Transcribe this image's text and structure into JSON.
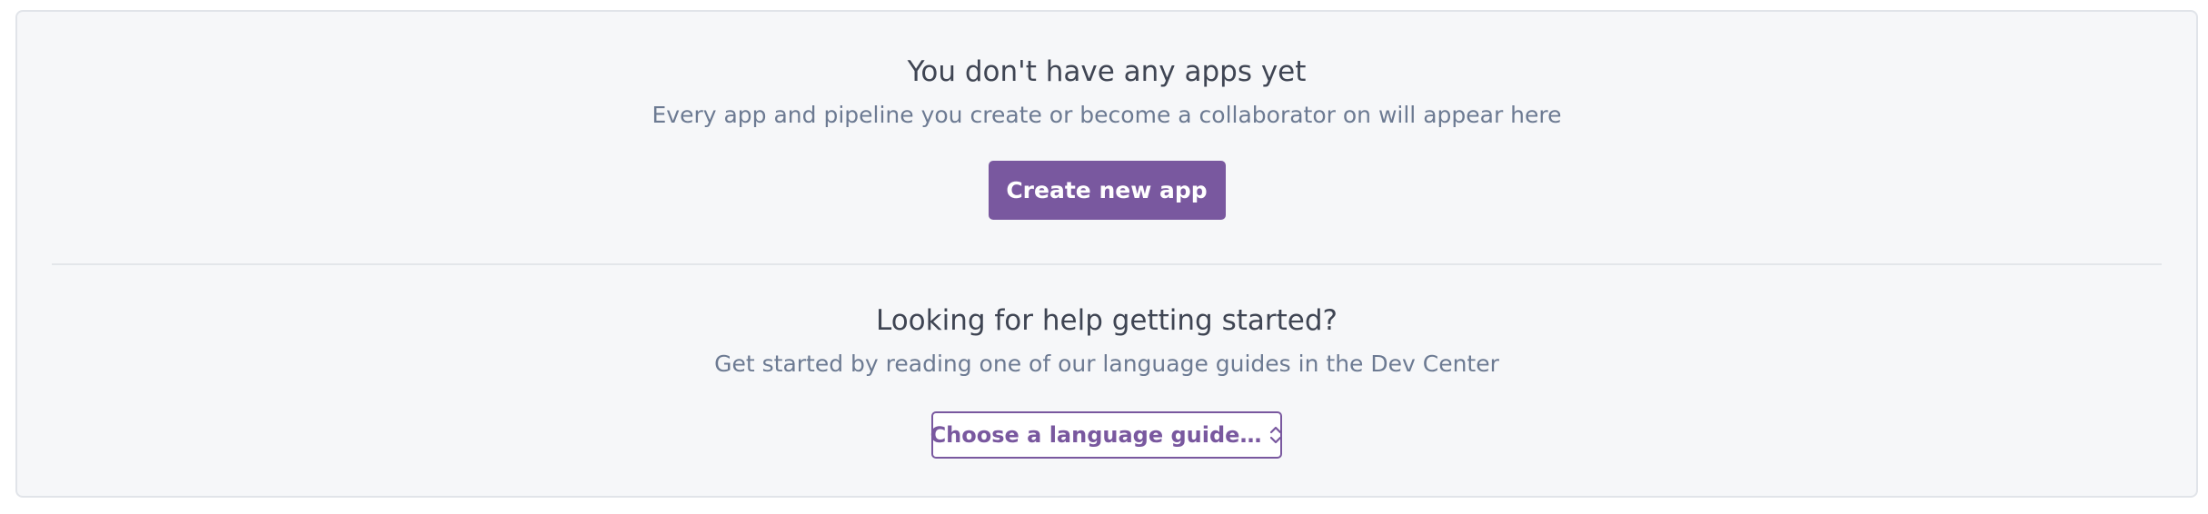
{
  "empty_state": {
    "title": "You don't have any apps yet",
    "subtitle": "Every app and pipeline you create or become a collaborator on will appear here",
    "create_button_label": "Create new app"
  },
  "help": {
    "title": "Looking for help getting started?",
    "subtitle": "Get started by reading one of our language guides in the Dev Center",
    "select_label": "Choose a language guide…"
  },
  "icons": {
    "select_indicator": "chevron-up-down-icon"
  },
  "colors": {
    "accent": "#79589f",
    "panel_background": "#f6f7f9",
    "title_text": "#3f4553",
    "subtitle_text": "#6c7a92"
  }
}
